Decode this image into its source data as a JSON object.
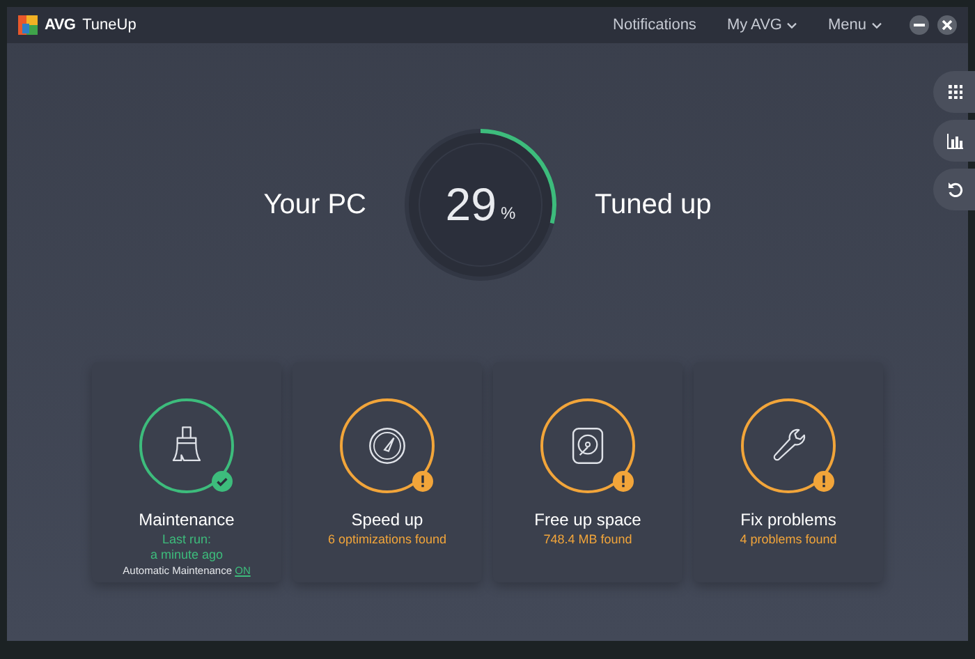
{
  "app": {
    "brand": "AVG",
    "name": "TuneUp"
  },
  "header_menu": [
    {
      "label": "Notifications",
      "dropdown": false
    },
    {
      "label": "My AVG",
      "dropdown": true
    },
    {
      "label": "Menu",
      "dropdown": true
    }
  ],
  "score": {
    "left_label": "Your PC",
    "value": "29",
    "unit": "%",
    "right_label": "Tuned up",
    "level": 0.29
  },
  "cards": [
    {
      "title": "Maintenance",
      "kind": "ok",
      "details": [
        "Last run:",
        "a minute ago"
      ],
      "footer": {
        "text": "Automatic Maintenance",
        "link": "ON"
      }
    },
    {
      "title": "Speed up",
      "kind": "warning",
      "details": [
        "6 optimizations found"
      ]
    },
    {
      "title": "Free up space",
      "kind": "warning",
      "details": [
        "748.4 MB found"
      ]
    },
    {
      "title": "Fix problems",
      "kind": "warning",
      "details": [
        "4 problems found"
      ]
    }
  ]
}
